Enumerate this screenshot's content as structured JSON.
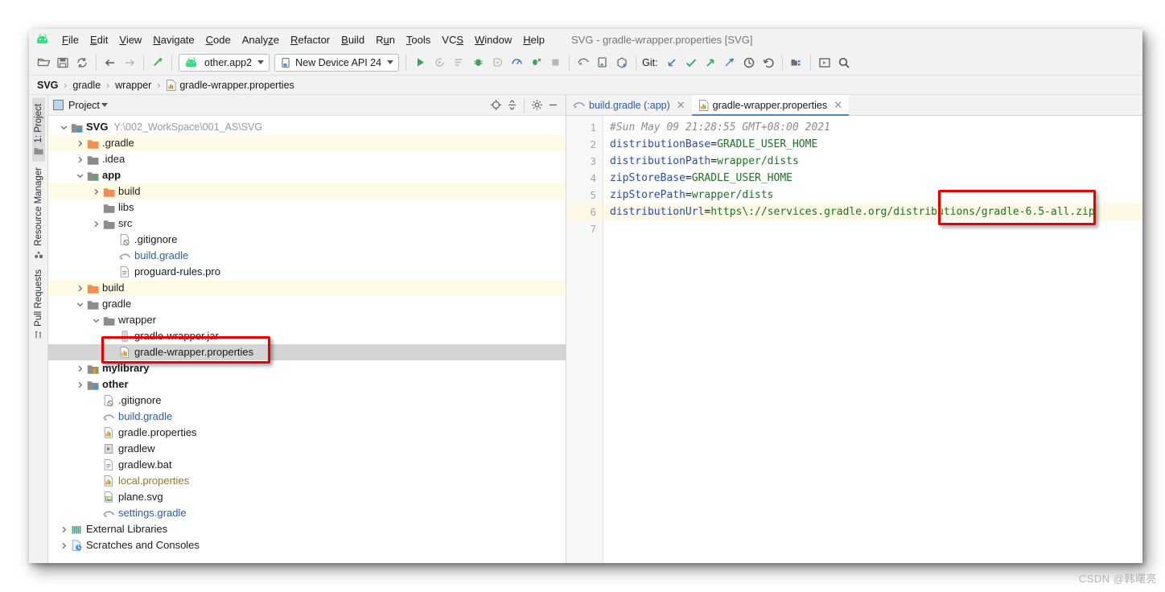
{
  "window": {
    "title": "SVG - gradle-wrapper.properties [SVG]"
  },
  "menu": {
    "items": [
      {
        "label": "File",
        "mnemonic": "F"
      },
      {
        "label": "Edit",
        "mnemonic": "E"
      },
      {
        "label": "View",
        "mnemonic": "V"
      },
      {
        "label": "Navigate",
        "mnemonic": "N"
      },
      {
        "label": "Code",
        "mnemonic": "C"
      },
      {
        "label": "Analyze",
        "mnemonic": "z"
      },
      {
        "label": "Refactor",
        "mnemonic": "R"
      },
      {
        "label": "Build",
        "mnemonic": "B"
      },
      {
        "label": "Run",
        "mnemonic": "u"
      },
      {
        "label": "Tools",
        "mnemonic": "T"
      },
      {
        "label": "VCS",
        "mnemonic": "S"
      },
      {
        "label": "Window",
        "mnemonic": "W"
      },
      {
        "label": "Help",
        "mnemonic": "H"
      }
    ]
  },
  "toolbar": {
    "module_selector": "other.app2",
    "device_selector": "New Device API 24",
    "git_label": "Git:",
    "icons_left": [
      "open-folder-icon",
      "save-all-icon",
      "sync-icon"
    ],
    "nav_icons": [
      "back-arrow-icon",
      "forward-arrow-icon"
    ],
    "build_icon": "hammer-icon",
    "run_icons": [
      "run-icon",
      "apply-changes-icon",
      "run-with-coverage-icon",
      "debug-icon",
      "attach-debugger-icon",
      "profiler-icon",
      "apply-code-changes-icon",
      "stop-icon"
    ],
    "device_icons": [
      "avd-manager-icon",
      "sdk-manager-icon",
      "sync-project-icon"
    ],
    "git_icons": [
      "update-project-icon",
      "commit-icon",
      "push-icon",
      "shelve-icon",
      "history-icon",
      "revert-icon"
    ],
    "right_icons": [
      "project-structure-icon",
      "layout-inspector-icon",
      "search-everywhere-icon"
    ]
  },
  "breadcrumb": {
    "items": [
      "SVG",
      "gradle",
      "wrapper",
      "gradle-wrapper.properties"
    ],
    "separator": "›"
  },
  "tool_strips": {
    "left": [
      {
        "label": "1: Project",
        "icon": "project-folder-icon",
        "active": true
      },
      {
        "label": "Resource Manager",
        "icon": "resource-manager-icon",
        "active": false
      },
      {
        "label": "Pull Requests",
        "icon": "pull-requests-icon",
        "active": false
      }
    ]
  },
  "project_panel": {
    "title": "Project",
    "header_icons": [
      "locate-icon",
      "collapse-all-icon",
      "settings-gear-icon",
      "hide-minimize-icon"
    ],
    "tree": [
      {
        "depth": 0,
        "label": "SVG",
        "suffix": "Y:\\002_WorkSpace\\001_AS\\SVG",
        "icon": "module-folder-icon",
        "twisty": "expanded",
        "bold": true,
        "state": "normal"
      },
      {
        "depth": 1,
        "label": ".gradle",
        "suffix": "",
        "icon": "excluded-folder-icon",
        "twisty": "collapsed",
        "bold": false,
        "state": "excluded"
      },
      {
        "depth": 1,
        "label": ".idea",
        "suffix": "",
        "icon": "folder-icon",
        "twisty": "collapsed",
        "bold": false,
        "state": "normal"
      },
      {
        "depth": 1,
        "label": "app",
        "suffix": "",
        "icon": "module-folder-green-icon",
        "twisty": "expanded",
        "bold": true,
        "state": "normal"
      },
      {
        "depth": 2,
        "label": "build",
        "suffix": "",
        "icon": "excluded-folder-icon",
        "twisty": "collapsed",
        "bold": false,
        "state": "excluded"
      },
      {
        "depth": 2,
        "label": "libs",
        "suffix": "",
        "icon": "folder-icon",
        "twisty": "none",
        "bold": false,
        "state": "normal"
      },
      {
        "depth": 2,
        "label": "src",
        "suffix": "",
        "icon": "folder-icon",
        "twisty": "collapsed",
        "bold": false,
        "state": "normal"
      },
      {
        "depth": 3,
        "label": ".gitignore",
        "suffix": "",
        "icon": "gitignore-file-icon",
        "twisty": "none",
        "bold": false,
        "state": "normal"
      },
      {
        "depth": 3,
        "label": "build.gradle",
        "suffix": "",
        "icon": "gradle-file-icon",
        "twisty": "none",
        "bold": false,
        "state": "link"
      },
      {
        "depth": 3,
        "label": "proguard-rules.pro",
        "suffix": "",
        "icon": "text-file-icon",
        "twisty": "none",
        "bold": false,
        "state": "normal"
      },
      {
        "depth": 1,
        "label": "build",
        "suffix": "",
        "icon": "excluded-folder-icon",
        "twisty": "collapsed",
        "bold": false,
        "state": "excluded"
      },
      {
        "depth": 1,
        "label": "gradle",
        "suffix": "",
        "icon": "folder-icon",
        "twisty": "expanded",
        "bold": false,
        "state": "normal"
      },
      {
        "depth": 2,
        "label": "wrapper",
        "suffix": "",
        "icon": "folder-icon",
        "twisty": "expanded",
        "bold": false,
        "state": "normal"
      },
      {
        "depth": 3,
        "label": "gradle-wrapper.jar",
        "suffix": "",
        "icon": "jar-file-icon",
        "twisty": "none",
        "bold": false,
        "state": "normal"
      },
      {
        "depth": 3,
        "label": "gradle-wrapper.properties",
        "suffix": "",
        "icon": "properties-file-icon",
        "twisty": "none",
        "bold": false,
        "state": "selected"
      },
      {
        "depth": 1,
        "label": "mylibrary",
        "suffix": "",
        "icon": "library-module-icon",
        "twisty": "collapsed",
        "bold": true,
        "state": "normal"
      },
      {
        "depth": 1,
        "label": "other",
        "suffix": "",
        "icon": "module-folder-blue-icon",
        "twisty": "collapsed",
        "bold": true,
        "state": "normal"
      },
      {
        "depth": 2,
        "label": ".gitignore",
        "suffix": "",
        "icon": "gitignore-file-icon",
        "twisty": "none",
        "bold": false,
        "state": "normal"
      },
      {
        "depth": 2,
        "label": "build.gradle",
        "suffix": "",
        "icon": "gradle-file-icon",
        "twisty": "none",
        "bold": false,
        "state": "link"
      },
      {
        "depth": 2,
        "label": "gradle.properties",
        "suffix": "",
        "icon": "properties-file-icon",
        "twisty": "none",
        "bold": false,
        "state": "normal"
      },
      {
        "depth": 2,
        "label": "gradlew",
        "suffix": "",
        "icon": "script-file-icon",
        "twisty": "none",
        "bold": false,
        "state": "normal"
      },
      {
        "depth": 2,
        "label": "gradlew.bat",
        "suffix": "",
        "icon": "text-file-icon",
        "twisty": "none",
        "bold": false,
        "state": "normal"
      },
      {
        "depth": 2,
        "label": "local.properties",
        "suffix": "",
        "icon": "properties-file-icon",
        "twisty": "none",
        "bold": false,
        "state": "ignored"
      },
      {
        "depth": 2,
        "label": "plane.svg",
        "suffix": "",
        "icon": "image-file-icon",
        "twisty": "none",
        "bold": false,
        "state": "normal"
      },
      {
        "depth": 2,
        "label": "settings.gradle",
        "suffix": "",
        "icon": "gradle-file-icon",
        "twisty": "none",
        "bold": false,
        "state": "link"
      },
      {
        "depth": 0,
        "label": "External Libraries",
        "suffix": "",
        "icon": "external-libraries-icon",
        "twisty": "collapsed",
        "bold": false,
        "state": "normal"
      },
      {
        "depth": 0,
        "label": "Scratches and Consoles",
        "suffix": "",
        "icon": "scratches-icon",
        "twisty": "collapsed",
        "bold": false,
        "state": "normal"
      }
    ]
  },
  "editor": {
    "tabs": [
      {
        "label": "build.gradle (:app)",
        "icon": "gradle-file-icon",
        "active": false
      },
      {
        "label": "gradle-wrapper.properties",
        "icon": "properties-file-icon",
        "active": true
      }
    ],
    "line_numbers": [
      "1",
      "2",
      "3",
      "4",
      "5",
      "6",
      "7"
    ],
    "current_line": 6,
    "lines": [
      {
        "n": 1,
        "type": "comment",
        "text": "#Sun May 09 21:28:55 GMT+08:00 2021"
      },
      {
        "n": 2,
        "type": "kv",
        "key": "distributionBase",
        "value": "GRADLE_USER_HOME"
      },
      {
        "n": 3,
        "type": "kv",
        "key": "distributionPath",
        "value": "wrapper/dists"
      },
      {
        "n": 4,
        "type": "kv",
        "key": "zipStoreBase",
        "value": "GRADLE_USER_HOME"
      },
      {
        "n": 5,
        "type": "kv",
        "key": "zipStorePath",
        "value": "wrapper/dists"
      },
      {
        "n": 6,
        "type": "kv",
        "key": "distributionUrl",
        "value": "https\\://services.gradle.org/distributions/gradle-6.5-all.zip"
      },
      {
        "n": 7,
        "type": "empty",
        "text": ""
      }
    ]
  },
  "annotations": {
    "highlight_tree_item": "gradle-wrapper.properties",
    "highlight_code_fragment": "ns/gradle-6.5-all.zip",
    "box_color": "#e60000"
  },
  "watermark": "CSDN @韩曙亮"
}
